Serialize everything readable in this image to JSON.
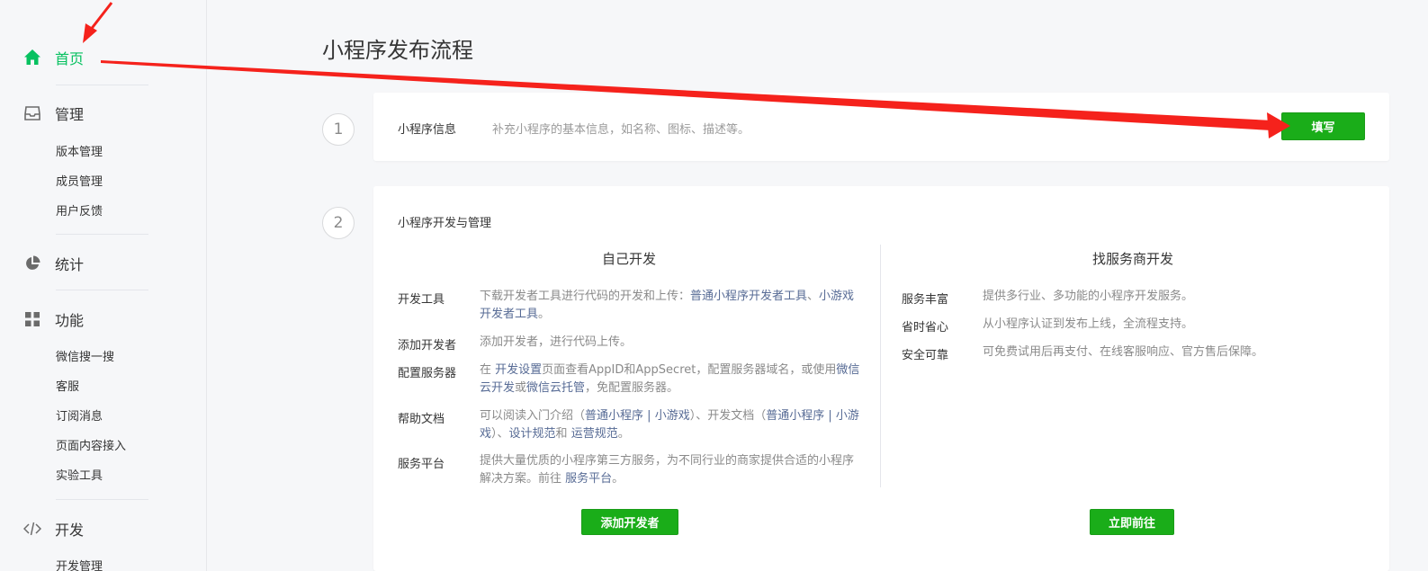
{
  "sidebar": {
    "home": "首页",
    "manage": "管理",
    "manage_items": [
      "版本管理",
      "成员管理",
      "用户反馈"
    ],
    "stats": "统计",
    "features": "功能",
    "feature_items": [
      "微信搜一搜",
      "客服",
      "订阅消息",
      "页面内容接入",
      "实验工具"
    ],
    "develop": "开发",
    "develop_partial": "开发管理"
  },
  "main": {
    "title": "小程序发布流程",
    "step1": {
      "number": "1",
      "label": "小程序信息",
      "desc": "补充小程序的基本信息，如名称、图标、描述等。",
      "button": "填写"
    },
    "step2": {
      "number": "2",
      "title": "小程序开发与管理",
      "self_dev": {
        "heading": "自己开发",
        "rows": [
          {
            "label": "开发工具",
            "text1": "下载开发者工具进行代码的开发和上传：",
            "link1": "普通小程序开发者工具",
            "sep": "、",
            "link2": "小游戏开发者工具",
            "end": "。"
          },
          {
            "label": "添加开发者",
            "text1": "添加开发者，进行代码上传。"
          },
          {
            "label": "配置服务器",
            "text1": "在 ",
            "link1": "开发设置",
            "text2": "页面查看AppID和AppSecret，配置服务器域名，或使用",
            "link2": "微信云开发",
            "text3": "或",
            "link3": "微信云托管",
            "text4": "，免配置服务器。"
          },
          {
            "label": "帮助文档",
            "text1": "可以阅读入门介绍（",
            "link1": "普通小程序",
            "pipe1": " | ",
            "link2": "小游戏",
            "text2": "）、开发文档（",
            "link3": "普通小程序",
            "pipe2": " | ",
            "link4": "小游戏",
            "text3": "）、",
            "link5": "设计规范",
            "text4": "和 ",
            "link6": "运营规范",
            "end": "。"
          },
          {
            "label": "服务平台",
            "text1": "提供大量优质的小程序第三方服务，为不同行业的商家提供合适的小程序解决方案。前往 ",
            "link1": "服务平台",
            "end": "。"
          }
        ],
        "button": "添加开发者"
      },
      "provider_dev": {
        "heading": "找服务商开发",
        "rows": [
          {
            "label": "服务丰富",
            "text": "提供多行业、多功能的小程序开发服务。"
          },
          {
            "label": "省时省心",
            "text": "从小程序认证到发布上线，全流程支持。"
          },
          {
            "label": "安全可靠",
            "text": "可免费试用后再支付、在线客服响应、官方售后保障。"
          }
        ],
        "button": "立即前往"
      }
    }
  },
  "colors": {
    "accent": "#07c160",
    "button": "#1aad19",
    "link": "#576b95",
    "annotation": "#f5221c"
  }
}
